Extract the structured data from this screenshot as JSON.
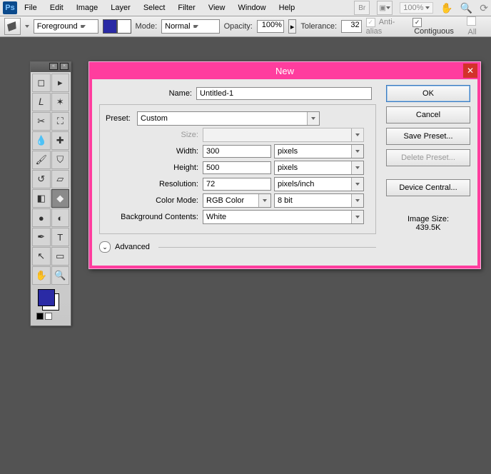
{
  "menubar": {
    "items": [
      "File",
      "Edit",
      "Image",
      "Layer",
      "Select",
      "Filter",
      "View",
      "Window",
      "Help"
    ],
    "br": "Br",
    "zoom": "100%"
  },
  "optbar": {
    "fill_source": "Foreground",
    "mode_label": "Mode:",
    "mode_value": "Normal",
    "opacity_label": "Opacity:",
    "opacity_value": "100%",
    "tolerance_label": "Tolerance:",
    "tolerance_value": "32",
    "antialias_label": "Anti-alias",
    "contiguous_label": "Contiguous",
    "alllayers_label": "All"
  },
  "dialog": {
    "title": "New",
    "name_label": "Name:",
    "name_value": "Untitled-1",
    "preset_label": "Preset:",
    "preset_value": "Custom",
    "size_label": "Size:",
    "width_label": "Width:",
    "width_value": "300",
    "width_unit": "pixels",
    "height_label": "Height:",
    "height_value": "500",
    "height_unit": "pixels",
    "resolution_label": "Resolution:",
    "resolution_value": "72",
    "resolution_unit": "pixels/inch",
    "colormode_label": "Color Mode:",
    "colormode_value": "RGB Color",
    "colordepth_value": "8 bit",
    "bgcontents_label": "Background Contents:",
    "bgcontents_value": "White",
    "advanced_label": "Advanced",
    "imagesize_label": "Image Size:",
    "imagesize_value": "439.5K",
    "buttons": {
      "ok": "OK",
      "cancel": "Cancel",
      "save_preset": "Save Preset...",
      "delete_preset": "Delete Preset...",
      "device_central": "Device Central..."
    }
  }
}
